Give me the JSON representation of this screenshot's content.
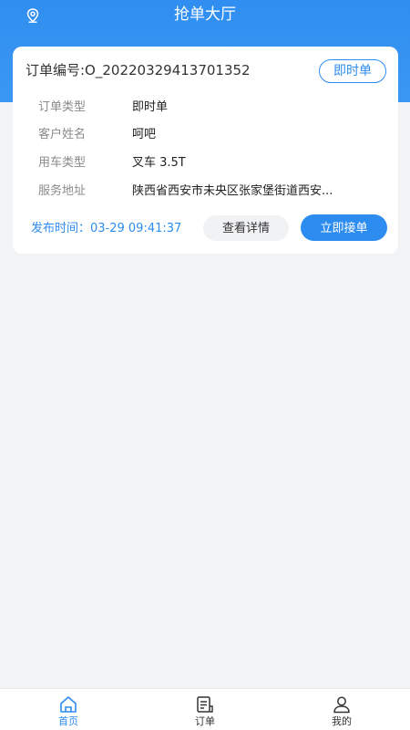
{
  "header": {
    "title": "抢单大厅",
    "location_icon": "location-pin-icon"
  },
  "order": {
    "number_text": "订单编号:O_20220329413701352",
    "type_tag": "即时单",
    "fields": [
      {
        "label": "订单类型",
        "value": "即时单"
      },
      {
        "label": "客户姓名",
        "value": "呵吧"
      },
      {
        "label": "用车类型",
        "value": "叉车 3.5T"
      },
      {
        "label": "服务地址",
        "value": "陕西省西安市未央区张家堡街道西安..."
      }
    ],
    "publish_time": "发布时间：03-29 09:41:37",
    "detail_button": "查看详情",
    "accept_button": "立即接单"
  },
  "tabs": [
    {
      "label": "首页",
      "icon": "home-icon",
      "active": true
    },
    {
      "label": "订单",
      "icon": "order-list-icon",
      "active": false
    },
    {
      "label": "我的",
      "icon": "user-icon",
      "active": false
    }
  ],
  "colors": {
    "primary": "#2d8cf0",
    "header": "#3b97f3",
    "background": "#f2f3f5"
  }
}
